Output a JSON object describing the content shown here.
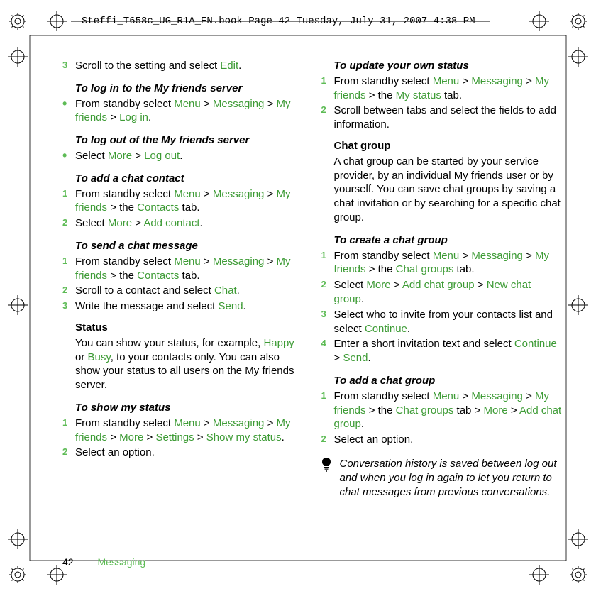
{
  "header": {
    "filename_line": "Steffi_T658c_UG_R1A_EN.book  Page 42  Tuesday, July 31, 2007  4:38 PM"
  },
  "footer": {
    "page_number": "42",
    "category": "Messaging"
  },
  "accent_color": "#3d9b35",
  "col1": {
    "step3": {
      "num": "3",
      "pre": "Scroll to the setting and select ",
      "hi1": "Edit",
      "post": "."
    },
    "login_title": "To log in to the My friends server",
    "login_step": {
      "pre": "From standby select ",
      "h1": "Menu",
      "s1": " > ",
      "h2": "Messaging",
      "s2": " > ",
      "h3": "My friends",
      "s3": " > ",
      "h4": "Log in",
      "post": "."
    },
    "logout_title": "To log out of the My friends server",
    "logout_step": {
      "pre": "Select ",
      "h1": "More",
      "s1": " > ",
      "h2": "Log out",
      "post": "."
    },
    "addcontact_title": "To add a chat contact",
    "addcontact_s1": {
      "num": "1",
      "pre": "From standby select ",
      "h1": "Menu",
      "s1": " >  ",
      "h2": "Messaging",
      "s2": " > ",
      "h3": "My friends",
      "s3": " > the ",
      "h4": "Contacts",
      "post": " tab."
    },
    "addcontact_s2": {
      "num": "2",
      "pre": "Select ",
      "h1": "More",
      "s1": " > ",
      "h2": "Add contact",
      "post": "."
    },
    "sendmsg_title": "To send a chat message",
    "sendmsg_s1": {
      "num": "1",
      "pre": "From standby select ",
      "h1": "Menu",
      "s1": " > ",
      "h2": "Messaging",
      "s2": " > ",
      "h3": "My friends",
      "s3": " > the ",
      "h4": "Contacts",
      "post": " tab."
    },
    "sendmsg_s2": {
      "num": "2",
      "pre": "Scroll to a contact and select ",
      "h1": "Chat",
      "post": "."
    },
    "sendmsg_s3": {
      "num": "3",
      "pre": "Write the message and select ",
      "h1": "Send",
      "post": "."
    },
    "status_head": "Status",
    "status_body": {
      "pre": "You can show your status, for example, ",
      "h1": "Happy",
      "mid1": " or ",
      "h2": "Busy",
      "post": ", to your contacts only. You can also show your status to all users on the My friends server."
    },
    "showstatus_title": "To show my status",
    "showstatus_s1": {
      "num": "1",
      "pre": "From standby select ",
      "h1": "Menu",
      "s1": " > ",
      "h2": "Messaging",
      "s2": " > ",
      "h3": "My friends",
      "s3": " > ",
      "h4": "More",
      "s4": " > ",
      "h5": "Settings",
      "s5": " > ",
      "h6": "Show my status",
      "post": "."
    },
    "showstatus_s2": {
      "num": "2",
      "text": "Select an option."
    }
  },
  "col2": {
    "update_title": "To update your own status",
    "update_s1": {
      "num": "1",
      "pre": "From standby select ",
      "h1": "Menu",
      "s1": " > ",
      "h2": "Messaging",
      "s2": " > ",
      "h3": "My friends",
      "s3": " > the ",
      "h4": "My status",
      "post": " tab."
    },
    "update_s2": {
      "num": "2",
      "text": "Scroll between tabs and select the fields to add information."
    },
    "chatgroup_head": "Chat group",
    "chatgroup_body": "A chat group can be started by your service provider, by an individual My friends user or by yourself. You can save chat groups by saving a chat invitation or by searching for a specific chat group.",
    "create_title": "To create a chat group",
    "create_s1": {
      "num": "1",
      "pre": "From standby select ",
      "h1": "Menu",
      "s1": " > ",
      "h2": "Messaging",
      "s2": " > ",
      "h3": "My friends",
      "s3": " > the ",
      "h4": "Chat groups",
      "post": " tab."
    },
    "create_s2": {
      "num": "2",
      "pre": "Select ",
      "h1": "More",
      "s1": " > ",
      "h2": "Add chat group",
      "s2": " > ",
      "h3": "New chat group",
      "post": "."
    },
    "create_s3": {
      "num": "3",
      "pre": "Select who to invite from your contacts list and select ",
      "h1": "Continue",
      "post": "."
    },
    "create_s4": {
      "num": "4",
      "pre": "Enter a short invitation text and select ",
      "h1": "Continue",
      "s1": " > ",
      "h2": "Send",
      "post": "."
    },
    "addgroup_title": "To add a chat group",
    "addgroup_s1": {
      "num": "1",
      "pre": "From standby select ",
      "h1": "Menu",
      "s1": " > ",
      "h2": "Messaging",
      "s2": " > ",
      "h3": "My friends",
      "s3": " > the ",
      "h4": "Chat groups",
      "s4": " tab > ",
      "h5": "More",
      "s5": " > ",
      "h6": "Add chat group",
      "post": "."
    },
    "addgroup_s2": {
      "num": "2",
      "text": "Select an option."
    },
    "tip_text": "Conversation history is saved between log out and when you log in again to let you return to chat messages from previous conversations."
  }
}
